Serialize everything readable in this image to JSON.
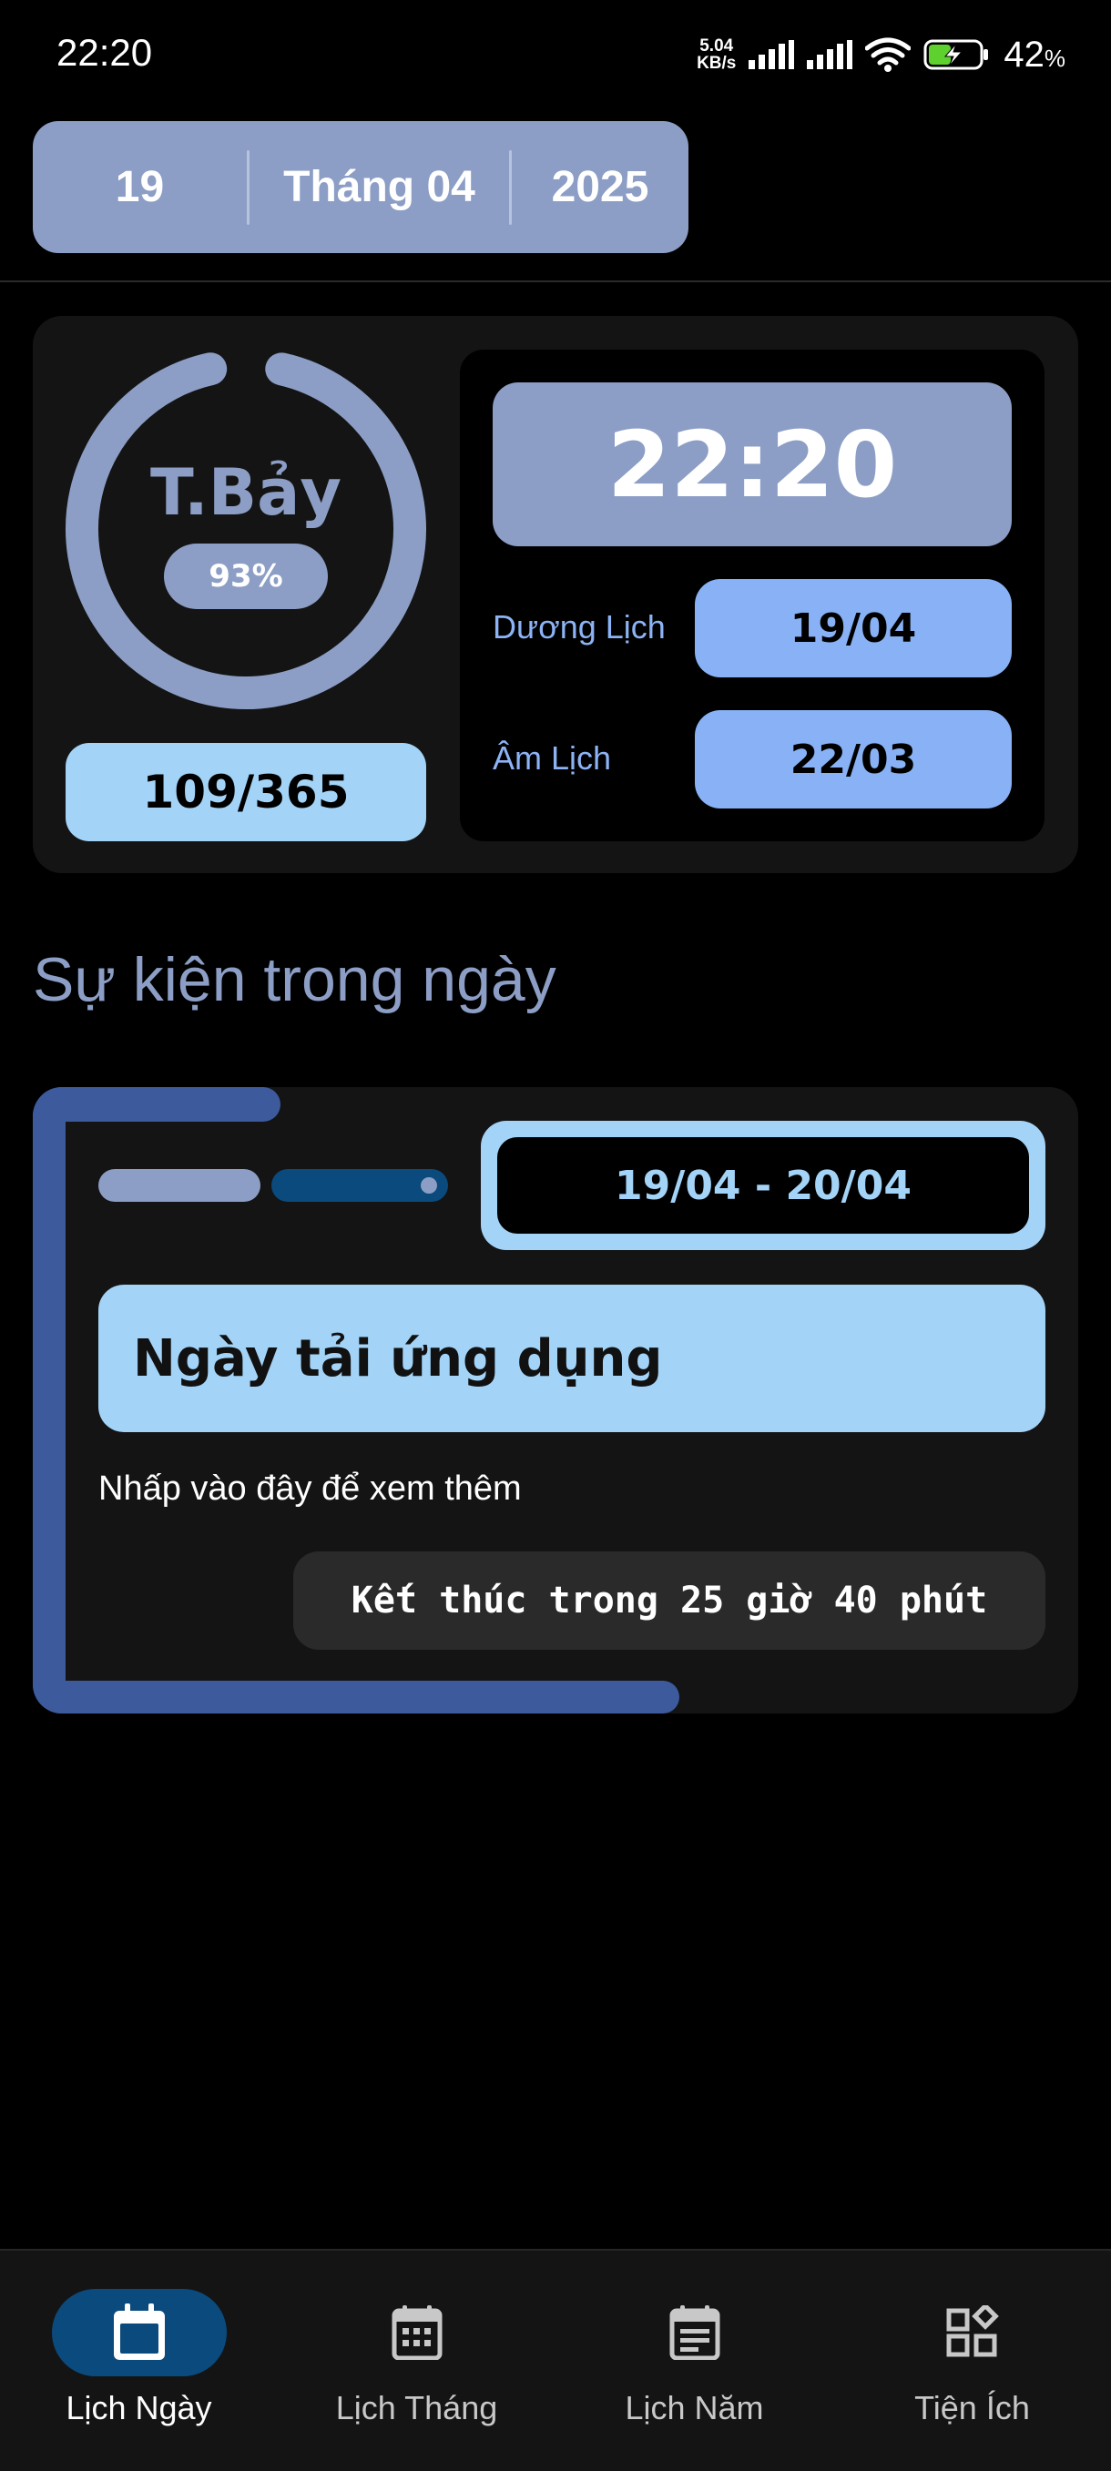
{
  "status_bar": {
    "time": "22:20",
    "net_speed_value": "5.04",
    "net_speed_unit": "KB/s",
    "battery_percent": "42",
    "battery_unit": "%",
    "icons": [
      "signal-icon",
      "signal-icon",
      "wifi-icon",
      "battery-charging-icon"
    ],
    "battery_color": "#5ed12e"
  },
  "date_picker": {
    "day": "19",
    "month": "Tháng 04",
    "year": "2025"
  },
  "info_card": {
    "weekday": "T.Bảy",
    "progress_label": "93%",
    "progress_fraction": 0.93,
    "day_of_year": "109/365",
    "clock": "22:20",
    "solar_label": "Dương Lịch",
    "solar_date": "19/04",
    "lunar_label": "Âm Lịch",
    "lunar_date": "22/03"
  },
  "section": {
    "title": "Sự kiện trong ngày"
  },
  "event": {
    "date_range": "19/04 - 20/04",
    "title": "Ngày tải ứng dụng",
    "hint": "Nhấp vào đây để xem thêm",
    "countdown": "Kết thúc trong 25 giờ 40 phút"
  },
  "bottom_nav": {
    "items": [
      {
        "label": "Lịch Ngày",
        "icon": "calendar-day-icon",
        "active": true
      },
      {
        "label": "Lịch Tháng",
        "icon": "calendar-month-icon",
        "active": false
      },
      {
        "label": "Lịch Năm",
        "icon": "calendar-year-icon",
        "active": false
      },
      {
        "label": "Tiện Ích",
        "icon": "widgets-icon",
        "active": false
      }
    ]
  },
  "colors": {
    "accent": "#8c9ec5",
    "light_blue": "#a3d3f7",
    "blue_pill": "#88b2f5",
    "event_accent": "#3c5a9c",
    "nav_active": "#0b4a7c"
  }
}
